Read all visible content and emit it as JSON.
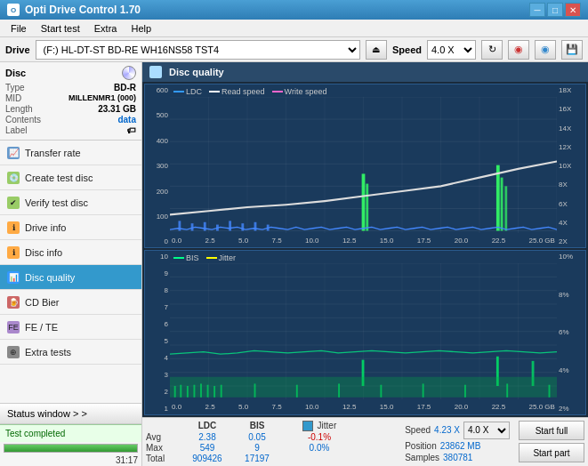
{
  "titlebar": {
    "title": "Opti Drive Control 1.70",
    "icon": "ODC",
    "min": "─",
    "max": "□",
    "close": "✕"
  },
  "menubar": {
    "items": [
      "File",
      "Start test",
      "Extra",
      "Help"
    ]
  },
  "drivebar": {
    "label": "Drive",
    "drive_value": "(F:)  HL-DT-ST BD-RE  WH16NS58 TST4",
    "speed_label": "Speed",
    "speed_value": "4.0 X"
  },
  "disc_panel": {
    "title": "Disc",
    "type_label": "Type",
    "type_value": "BD-R",
    "mid_label": "MID",
    "mid_value": "MILLENMR1 (000)",
    "length_label": "Length",
    "length_value": "23.31 GB",
    "contents_label": "Contents",
    "contents_value": "data",
    "label_label": "Label",
    "label_value": ""
  },
  "sidebar": {
    "nav_items": [
      {
        "id": "transfer-rate",
        "label": "Transfer rate",
        "active": false
      },
      {
        "id": "create-test-disc",
        "label": "Create test disc",
        "active": false
      },
      {
        "id": "verify-test-disc",
        "label": "Verify test disc",
        "active": false
      },
      {
        "id": "drive-info",
        "label": "Drive info",
        "active": false
      },
      {
        "id": "disc-info",
        "label": "Disc info",
        "active": false
      },
      {
        "id": "disc-quality",
        "label": "Disc quality",
        "active": true
      },
      {
        "id": "cd-bier",
        "label": "CD Bier",
        "active": false
      },
      {
        "id": "fe-te",
        "label": "FE / TE",
        "active": false
      },
      {
        "id": "extra-tests",
        "label": "Extra tests",
        "active": false
      }
    ]
  },
  "chart_header": {
    "title": "Disc quality"
  },
  "chart1": {
    "title": "",
    "legend": [
      {
        "label": "LDC",
        "color": "#3399ff"
      },
      {
        "label": "Read speed",
        "color": "#ffffff"
      },
      {
        "label": "Write speed",
        "color": "#ff66cc"
      }
    ],
    "y_left": [
      "600",
      "500",
      "400",
      "300",
      "200",
      "100",
      "0"
    ],
    "y_right": [
      "18X",
      "16X",
      "14X",
      "12X",
      "10X",
      "8X",
      "6X",
      "4X",
      "2X"
    ],
    "x_labels": [
      "0.0",
      "2.5",
      "5.0",
      "7.5",
      "10.0",
      "12.5",
      "15.0",
      "17.5",
      "20.0",
      "22.5",
      "25.0 GB"
    ]
  },
  "chart2": {
    "legend": [
      {
        "label": "BIS",
        "color": "#00ff88"
      },
      {
        "label": "Jitter",
        "color": "#ffff00"
      }
    ],
    "y_left": [
      "10",
      "9",
      "8",
      "7",
      "6",
      "5",
      "4",
      "3",
      "2",
      "1"
    ],
    "y_right": [
      "10%",
      "8%",
      "6%",
      "4%",
      "2%"
    ],
    "x_labels": [
      "0.0",
      "2.5",
      "5.0",
      "7.5",
      "10.0",
      "12.5",
      "15.0",
      "17.5",
      "20.0",
      "22.5",
      "25.0 GB"
    ]
  },
  "stats": {
    "col_headers": [
      "",
      "LDC",
      "BIS",
      "",
      "Jitter",
      "Speed",
      ""
    ],
    "avg_label": "Avg",
    "avg_ldc": "2.38",
    "avg_bis": "0.05",
    "avg_jitter": "-0.1%",
    "max_label": "Max",
    "max_ldc": "549",
    "max_bis": "9",
    "max_jitter": "0.0%",
    "total_label": "Total",
    "total_ldc": "909426",
    "total_bis": "17197",
    "jitter_checked": true,
    "speed_label": "Speed",
    "speed_value": "4.23 X",
    "speed_select": "4.0 X",
    "position_label": "Position",
    "position_value": "23862 MB",
    "samples_label": "Samples",
    "samples_value": "380781",
    "btn_start_full": "Start full",
    "btn_start_part": "Start part"
  },
  "statusbar": {
    "status_window_label": "Status window > >",
    "status_text": "Test completed",
    "progress": 100,
    "time": "31:17"
  }
}
